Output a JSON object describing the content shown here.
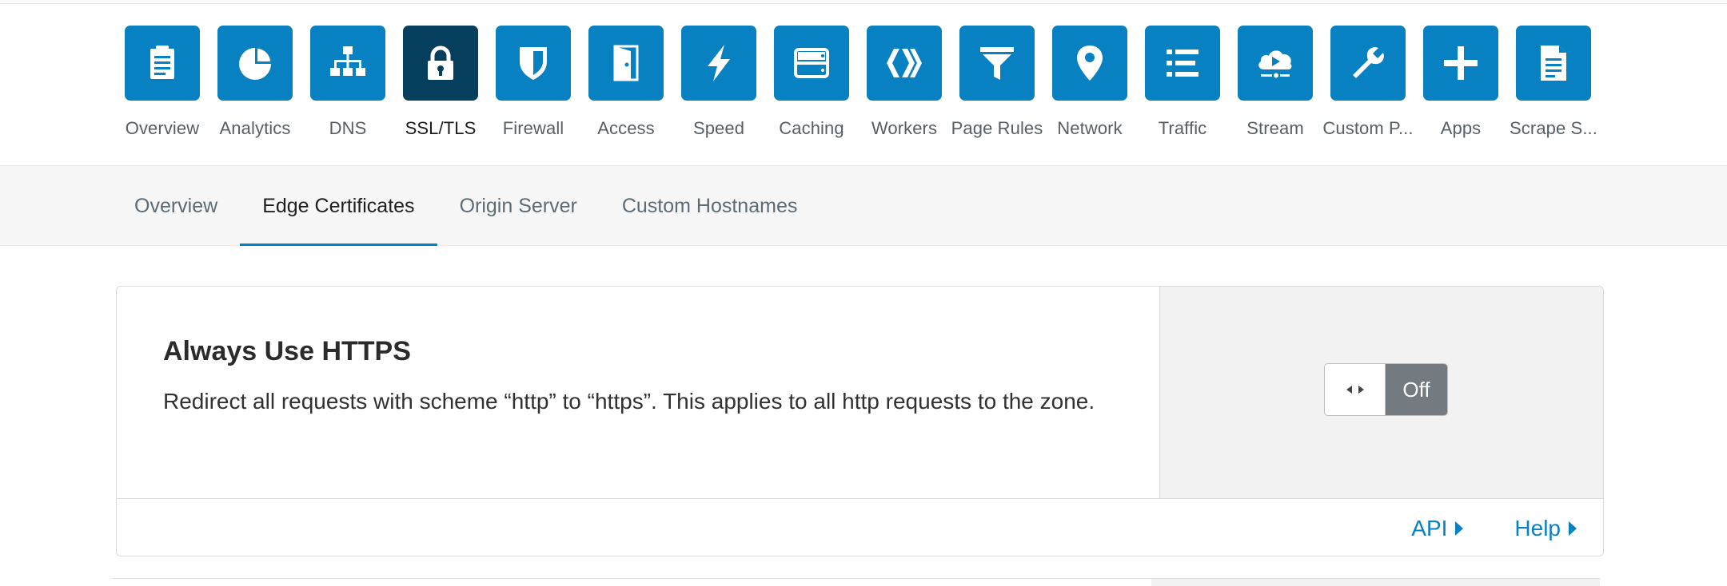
{
  "apps": [
    {
      "label": "Overview",
      "icon": "clipboard-icon"
    },
    {
      "label": "Analytics",
      "icon": "pie-chart-icon"
    },
    {
      "label": "DNS",
      "icon": "network-tree-icon"
    },
    {
      "label": "SSL/TLS",
      "icon": "lock-icon",
      "active": true
    },
    {
      "label": "Firewall",
      "icon": "shield-icon"
    },
    {
      "label": "Access",
      "icon": "door-icon"
    },
    {
      "label": "Speed",
      "icon": "lightning-icon"
    },
    {
      "label": "Caching",
      "icon": "server-icon"
    },
    {
      "label": "Workers",
      "icon": "workers-icon"
    },
    {
      "label": "Page Rules",
      "icon": "filter-icon"
    },
    {
      "label": "Network",
      "icon": "location-pin-icon"
    },
    {
      "label": "Traffic",
      "icon": "list-icon"
    },
    {
      "label": "Stream",
      "icon": "cloud-play-icon"
    },
    {
      "label": "Custom P...",
      "icon": "wrench-icon"
    },
    {
      "label": "Apps",
      "icon": "plus-icon"
    },
    {
      "label": "Scrape S...",
      "icon": "document-icon"
    }
  ],
  "subtabs": [
    {
      "label": "Overview"
    },
    {
      "label": "Edge Certificates",
      "active": true
    },
    {
      "label": "Origin Server"
    },
    {
      "label": "Custom Hostnames"
    }
  ],
  "card": {
    "title": "Always Use HTTPS",
    "description": "Redirect all requests with scheme “http” to “https”. This applies to all http requests to the zone.",
    "toggle_state": "Off",
    "api_label": "API",
    "help_label": "Help"
  },
  "colors": {
    "accent": "#0881c3",
    "active_tile": "#063f5d",
    "toggle_off": "#737a80"
  }
}
